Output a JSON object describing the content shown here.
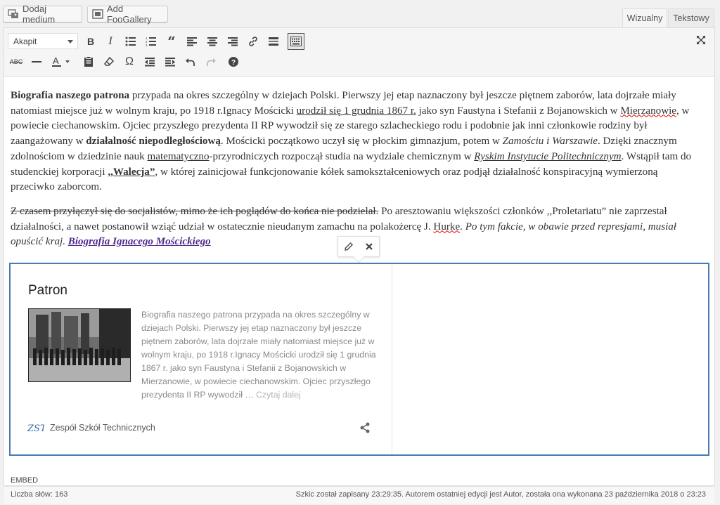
{
  "media_buttons": {
    "add_media": "Dodaj medium",
    "add_foogallery": "Add FooGallery"
  },
  "editor_tabs": {
    "visual": "Wizualny",
    "text": "Tekstowy"
  },
  "toolbar": {
    "format_select": "Akapit",
    "row1_icons": [
      "bold-icon",
      "italic-icon",
      "bullet-list-icon",
      "numbered-list-icon",
      "blockquote-icon",
      "align-left-icon",
      "align-center-icon",
      "align-right-icon",
      "link-icon",
      "read-more-icon",
      "toolbar-toggle-icon"
    ],
    "row2_icons": [
      "strikethrough-icon",
      "horizontal-line-icon",
      "text-color-icon",
      "paste-text-icon",
      "clear-formatting-icon",
      "special-character-icon",
      "outdent-icon",
      "indent-icon",
      "undo-icon",
      "redo-icon",
      "help-icon"
    ],
    "fullscreen_icon": "fullscreen-icon"
  },
  "content": {
    "p1": {
      "bold_lead": "Biografia naszego patrona",
      "t1": " przypada na okres szczególny w dziejach Polski. Pierwszy jej etap naznaczony był jeszcze piętnem zaborów, lata dojrzałe miały natomiast miejsce już w wolnym kraju, po 1918 r.Ignacy Mościcki ",
      "u1": "urodził się 1 grudnia 1867 r.",
      "t2": " jako syn Faustyna i Stefanii z Bojanowskich w ",
      "sp1": "Mierzanowie",
      "t3": ", w powiecie ciechanowskim. Ojciec przyszłego prezydenta II RP wywodził się ze starego szlacheckiego rodu i podobnie jak inni członkowie rodziny był zaangażowany w ",
      "b2": "działalność niepodległościową",
      "t4": ". Mościcki początkowo uczył się w płockim gimnazjum, potem w ",
      "i1": "Zamościu i Warszawie",
      "t5": ". Dzięki znacznym zdolnościom w dziedzinie nauk ",
      "u2": "matematyczno",
      "t6": "-przyrodniczych rozpoczął studia na wydziale chemicznym w ",
      "iu1": "Ryskim Instytucie Politechnicznym",
      "t7": ". Wstąpił tam do studenckiej korporacji ",
      "b3": ",,Walecja”",
      "t8": ", w której zainicjował funkcjonowanie kółek samokształceniowych oraz podjął działalność konspiracyjną wymierzoną przeciwko zaborcom."
    },
    "p2": {
      "strike": "Z czasem przyłączył się do socjalistów, mimo że ich poglądów do końca nie podzielał.",
      "t1": " Po aresztowaniu większości członków ,,Proletariatu” nie zaprzestał działalności, a nawet postanowił wziąć udział w ostatecznie nieudanym zamachu na polakożercę J. ",
      "sp1": "Hurke",
      "t2": ". ",
      "i1": "Po tym fakcie, w obawie przed represjami, musiał opuścić kraj.",
      "t3": " ",
      "link": "Biografia Ignacego Mościckiego"
    }
  },
  "embed_popup": {
    "edit_icon": "pencil-icon",
    "remove_icon": "close-icon"
  },
  "embed_card": {
    "title": "Patron",
    "excerpt": "Biografia naszego patrona przypada na okres szczególny w dziejach Polski. Pierwszy jej etap naznaczony był jeszcze piętnem zaborów, lata dojrzałe miały natomiast miejsce już w wolnym kraju, po 1918 r.Ignacy Mościcki urodził się 1 grudnia 1867 r. jako syn Faustyna i Stefanii z Bojanowskich w Mierzanowie, w powiecie ciechanowskim. Ojciec przyszłego prezydenta II RP wywodził … ",
    "read_more": "Czytaj dalej",
    "site_name": "Zespół Szkół Technicznych",
    "site_icon_text": "ZST"
  },
  "path_label": "EMBED",
  "status": {
    "word_count": "Liczba słów: 163",
    "saved": "Szkic został zapisany 23:29:35. Autorem ostatniej edycji jest Autor, została ona wykonana 23 października 2018 o 23:23"
  },
  "colors": {
    "embed_border": "#4a7ab0",
    "link": "#4f2a8c",
    "spellcheck": "#dd0000"
  }
}
